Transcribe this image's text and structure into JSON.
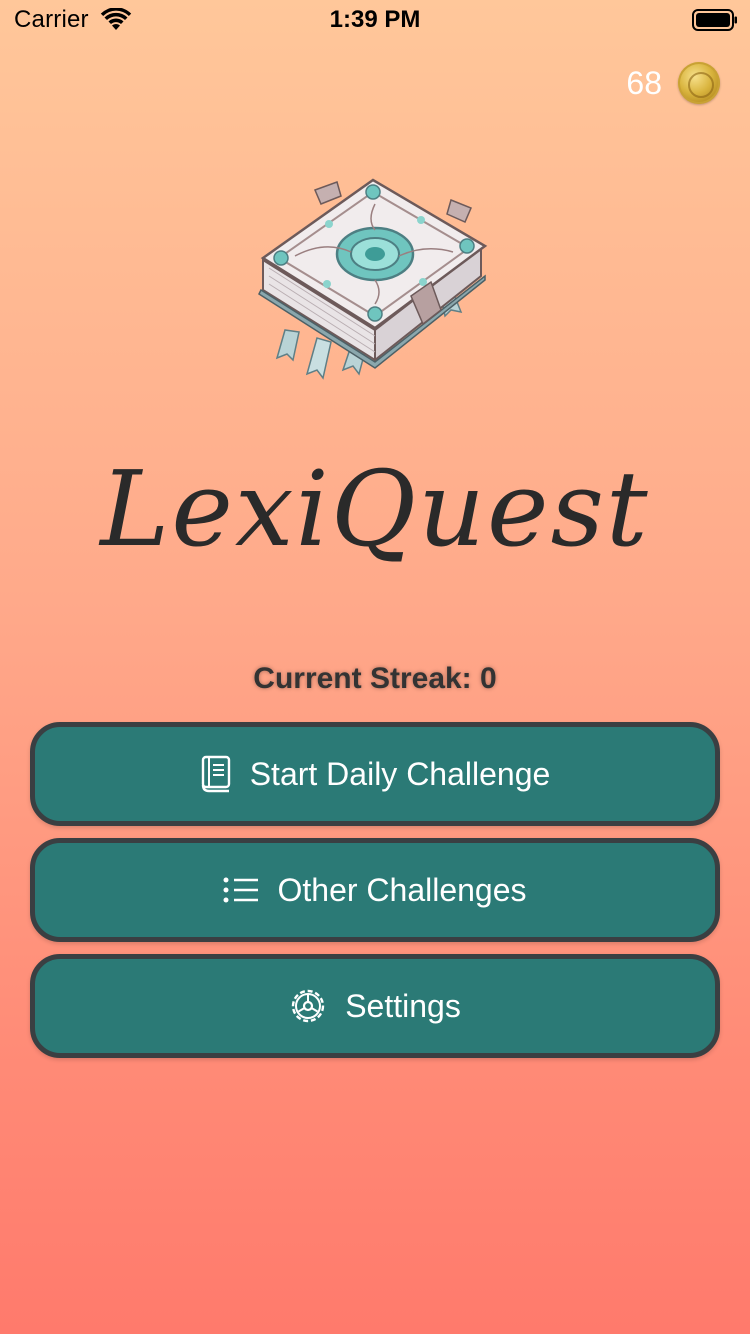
{
  "status_bar": {
    "carrier": "Carrier",
    "time": "1:39 PM"
  },
  "coins": {
    "count": "68"
  },
  "app": {
    "title": "LexiQuest"
  },
  "streak": {
    "label": "Current Streak: 0"
  },
  "buttons": {
    "daily": {
      "label": "Start Daily Challenge",
      "icon": "book-icon"
    },
    "other": {
      "label": "Other Challenges",
      "icon": "list-icon"
    },
    "settings": {
      "label": "Settings",
      "icon": "gear-icon"
    }
  },
  "colors": {
    "button_bg": "#2b7a76",
    "button_border": "#3a3f42",
    "gradient_top": "#ffc79a",
    "gradient_bottom": "#ff7a6c"
  }
}
